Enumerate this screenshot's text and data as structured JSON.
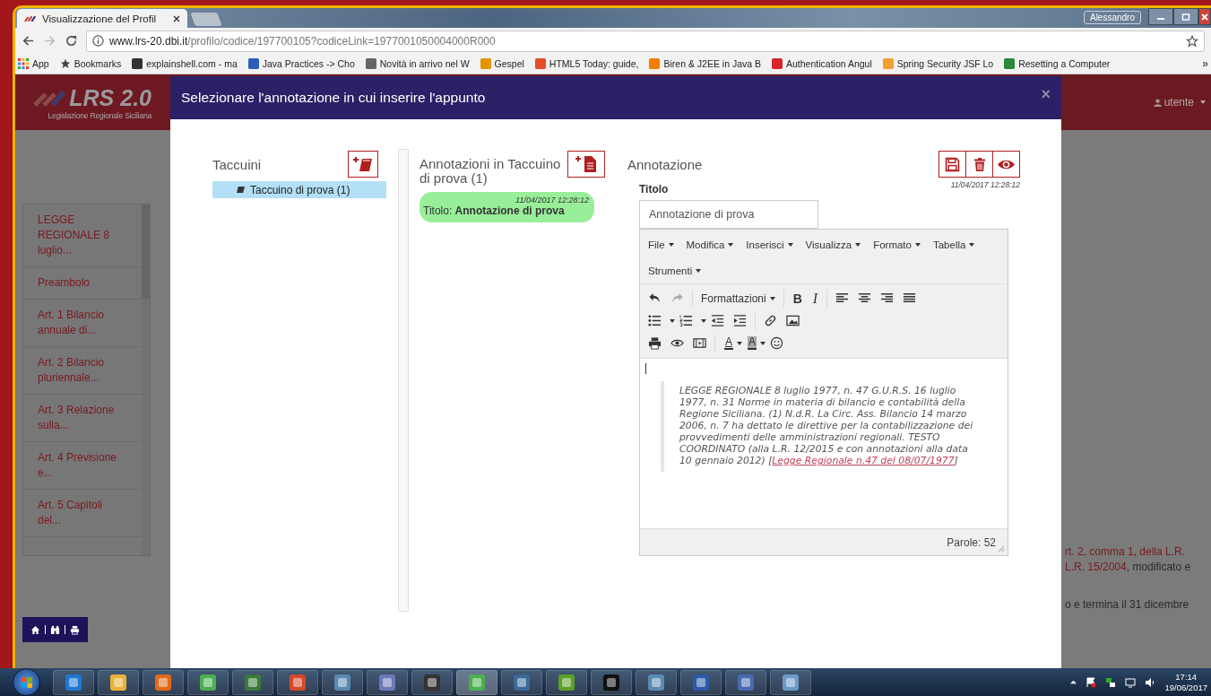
{
  "browser": {
    "tabs": [
      {
        "title": "Visualizzazione del Profil",
        "selected": true
      }
    ],
    "profile": "Alessandro",
    "address": {
      "host": "www.lrs-20.dbi.it",
      "path": "/profilo/codice/197700105?codiceLink=1977001050004000R000"
    },
    "bookmarks": [
      {
        "kind": "apps",
        "label": "App"
      },
      {
        "kind": "star",
        "label": "Bookmarks"
      },
      {
        "kind": "site",
        "label": "explainshell.com - ma",
        "color": "#333333"
      },
      {
        "kind": "site",
        "label": "Java Practices -> Cho",
        "color": "#2b5fb8"
      },
      {
        "kind": "site",
        "label": "Novità in arrivo nel W",
        "color": "#666666"
      },
      {
        "kind": "site",
        "label": "Gespel",
        "color": "#e59400"
      },
      {
        "kind": "site",
        "label": "HTML5 Today: guide,",
        "color": "#e44d26"
      },
      {
        "kind": "site",
        "label": "Biren & J2EE in Java B",
        "color": "#f57d00"
      },
      {
        "kind": "site",
        "label": "Authentication Angul",
        "color": "#d8232a"
      },
      {
        "kind": "site",
        "label": "Spring Security JSF Lo",
        "color": "#f0a030"
      },
      {
        "kind": "site",
        "label": "Resetting a Computer",
        "color": "#2a8a3a"
      }
    ],
    "more": "»"
  },
  "app": {
    "logo": {
      "title": "LRS 2.0",
      "subtitle": "Legislazione Regionale Siciliana"
    },
    "user": "utente",
    "sidebar": [
      "LEGGE REGIONALE 8 luglio...",
      "Preambolo",
      "Art. 1 Bilancio annuale di...",
      "Art. 2 Bilancio pluriennale...",
      "Art. 3 Relazione sulla...",
      "Art. 4 Previsione e...",
      "Art. 5 Capitoli del..."
    ],
    "page_text": [
      [
        {
          "text": "rt. 2, comma 1, della L.R.",
          "link": true
        }
      ],
      [
        {
          "text": "L.R. 15/2004",
          "link": true
        },
        {
          "text": ", modificato e",
          "link": false
        }
      ],
      [
        {
          "text": "o e termina il 31 dicembre",
          "link": false
        }
      ]
    ]
  },
  "modal": {
    "title": "Selezionare l'annotazione in cui inserire l'appunto",
    "close": "×",
    "notebooks": {
      "heading": "Taccuini",
      "items": [
        {
          "label": "Taccuino di prova (1)",
          "selected": true
        }
      ]
    },
    "annotations": {
      "heading": "Annotazioni in Taccuino di prova (1)",
      "items": [
        {
          "timestamp": "11/04/2017 12:28:12",
          "title": "Titolo: **Annotazione di prova**"
        }
      ]
    },
    "editor": {
      "heading": "Annotazione",
      "timestamp": "11/04/2017 12:28:12",
      "title_label": "Titolo",
      "title_value": "Annotazione di prova",
      "menus": [
        "File",
        "Modifica",
        "Inserisci",
        "Visualizza",
        "Formato",
        "Tabella",
        "Strumenti"
      ],
      "styles_dropdown": "Formattazioni",
      "bold": "B",
      "italic": "I",
      "text_color": "A",
      "background_color": "A",
      "quote": "LEGGE REGIONALE 8 luglio 1977, n. 47 G.U.R.S. 16 luglio 1977, n. 31 Norme in materia di bilancio e contabilità della Regione Siciliana. (1) N.d.R. La Circ. Ass. Bilancio 14 marzo 2006, n. 7 ha dettato le direttive per la contabilizzazione dei provvedimenti delle amministrazioni regionali. TESTO COORDINATO (alla L.R. 12/2015 e con annotazioni alla data 10 gennaio 2012) [",
      "quote_link": "Legge Regionale n.47 del 08/07/1977",
      "quote_end": "]",
      "word_count": "Parole: 52"
    }
  },
  "taskbar": {
    "time": "17:14",
    "date": "19/06/2017"
  }
}
